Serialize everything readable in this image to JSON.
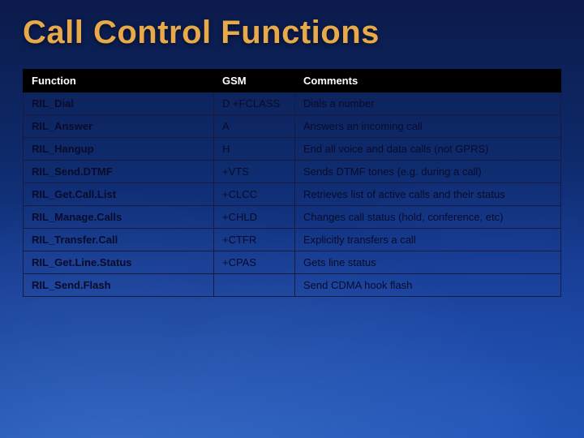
{
  "title": "Call Control Functions",
  "table": {
    "headers": [
      "Function",
      "GSM",
      "Comments"
    ],
    "rows": [
      {
        "function": "RIL_Dial",
        "gsm": "D +FCLASS",
        "comments": "Dials a number"
      },
      {
        "function": "RIL_Answer",
        "gsm": "A",
        "comments": "Answers an incoming call"
      },
      {
        "function": "RIL_Hangup",
        "gsm": "H",
        "comments": "End all voice and data calls (not GPRS)"
      },
      {
        "function": "RIL_Send.DTMF",
        "gsm": "+VTS",
        "comments": "Sends DTMF tones (e.g. during a call)"
      },
      {
        "function": "RIL_Get.Call.List",
        "gsm": "+CLCC",
        "comments": "Retrieves list of active calls and their status"
      },
      {
        "function": "RIL_Manage.Calls",
        "gsm": "+CHLD",
        "comments": "Changes call status (hold, conference, etc)"
      },
      {
        "function": "RIL_Transfer.Call",
        "gsm": "+CTFR",
        "comments": "Explicitly transfers a call"
      },
      {
        "function": "RIL_Get.Line.Status",
        "gsm": "+CPAS",
        "comments": "Gets line status"
      },
      {
        "function": "RIL_Send.Flash",
        "gsm": "",
        "comments": "Send CDMA hook flash"
      }
    ]
  }
}
